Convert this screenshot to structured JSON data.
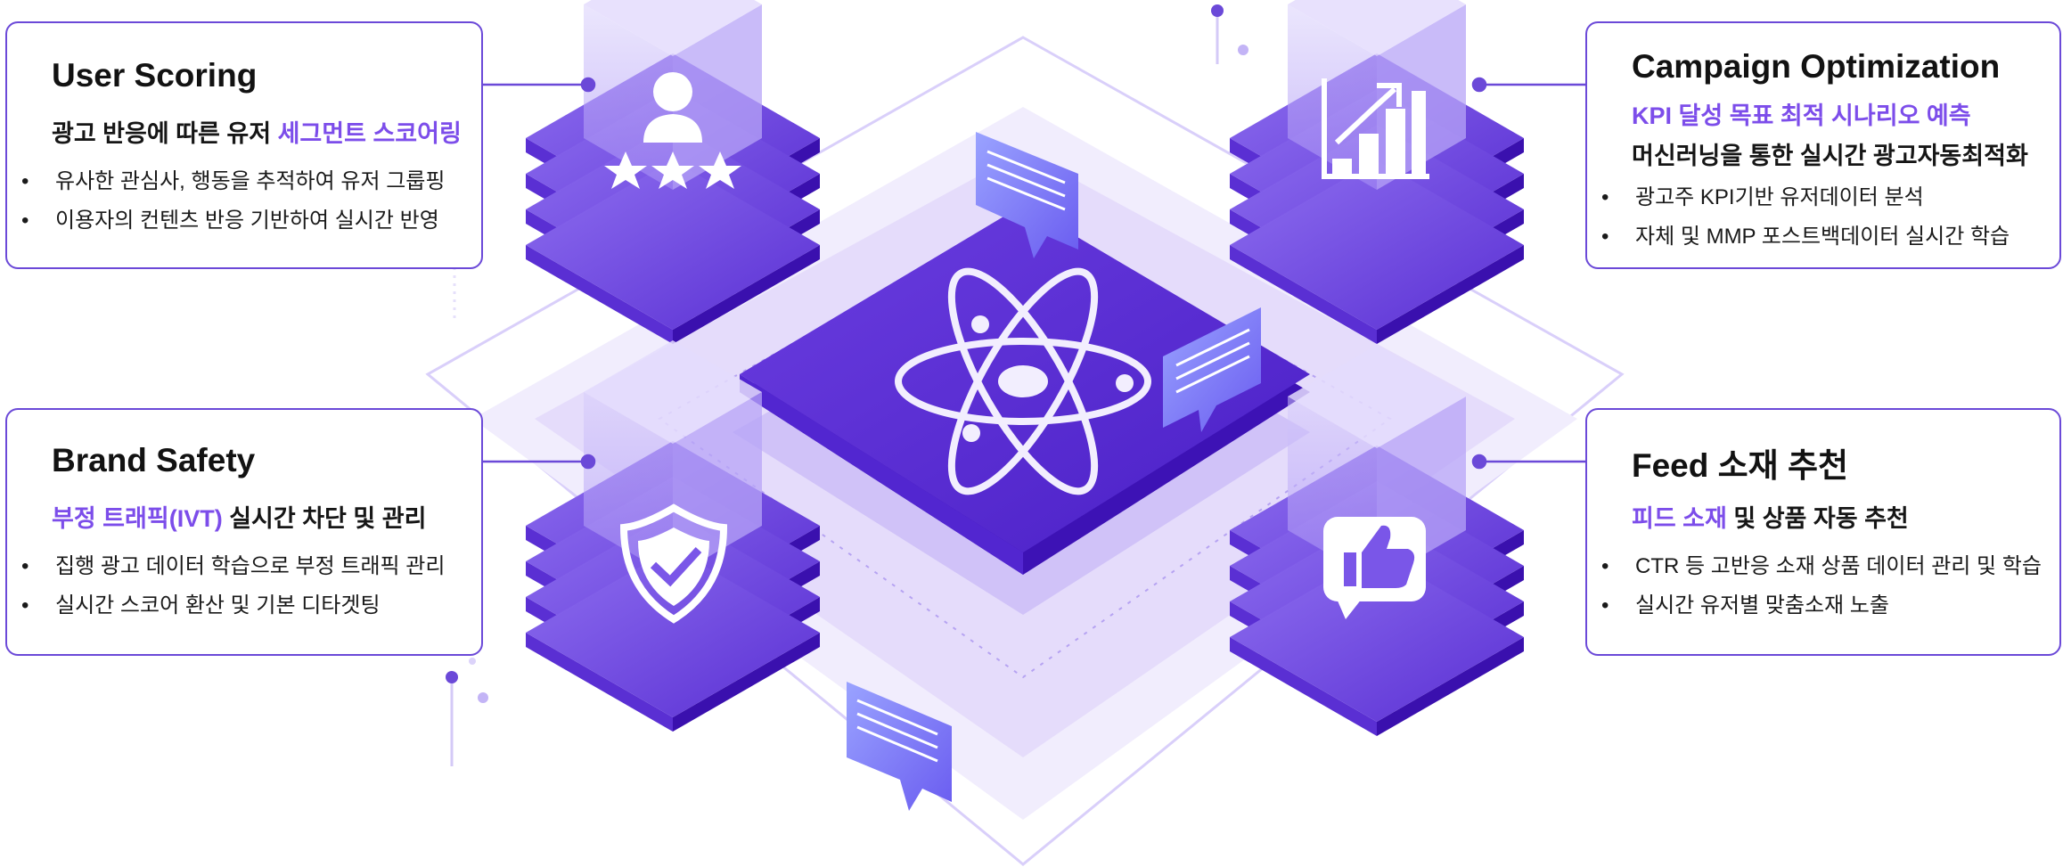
{
  "colors": {
    "accent": "#7c4dea",
    "border": "#6b49d8",
    "tile_top": "#7a56e8",
    "tile_dark": "#4a1fc6"
  },
  "cards": {
    "user_scoring": {
      "title": "User Scoring",
      "line_plain": "광고 반응에 따른 유저 ",
      "line_accent": "세그먼트 스코어링",
      "bullets": [
        "유사한 관심사, 행동을 추적하여 유저 그룹핑",
        "이용자의 컨텐츠 반응 기반하여 실시간 반영"
      ]
    },
    "campaign_optimization": {
      "title": "Campaign Optimization",
      "line_accent": "KPI 달성 목표 최적 시나리오 예측",
      "line_plain": "머신러닝을 통한 실시간 광고자동최적화",
      "bullets": [
        "광고주 KPI기반 유저데이터 분석",
        "자체 및 MMP 포스트백데이터 실시간 학습"
      ]
    },
    "brand_safety": {
      "title": "Brand Safety",
      "line_accent": "부정 트래픽(IVT)",
      "line_plain": " 실시간 차단 및 관리",
      "bullets": [
        "집행 광고 데이터 학습으로 부정 트래픽 관리",
        "실시간 스코어 환산 및 기본 디타겟팅"
      ]
    },
    "feed_recommendation": {
      "title": "Feed 소재 추천",
      "line_accent": "피드 소재",
      "line_plain": " 및 상품 자동 추천",
      "bullets": [
        "CTR 등 고반응 소재 상품 데이터 관리 및 학습",
        "실시간 유저별 맞춤소재 노출"
      ]
    }
  },
  "icons": {
    "user_scoring": "user-stars-icon",
    "campaign": "growth-bar-chart-icon",
    "brand_safety": "shield-check-icon",
    "feed": "thumbs-up-icon",
    "center": "atom-icon",
    "bubbles": "chat-bubble-icon"
  }
}
